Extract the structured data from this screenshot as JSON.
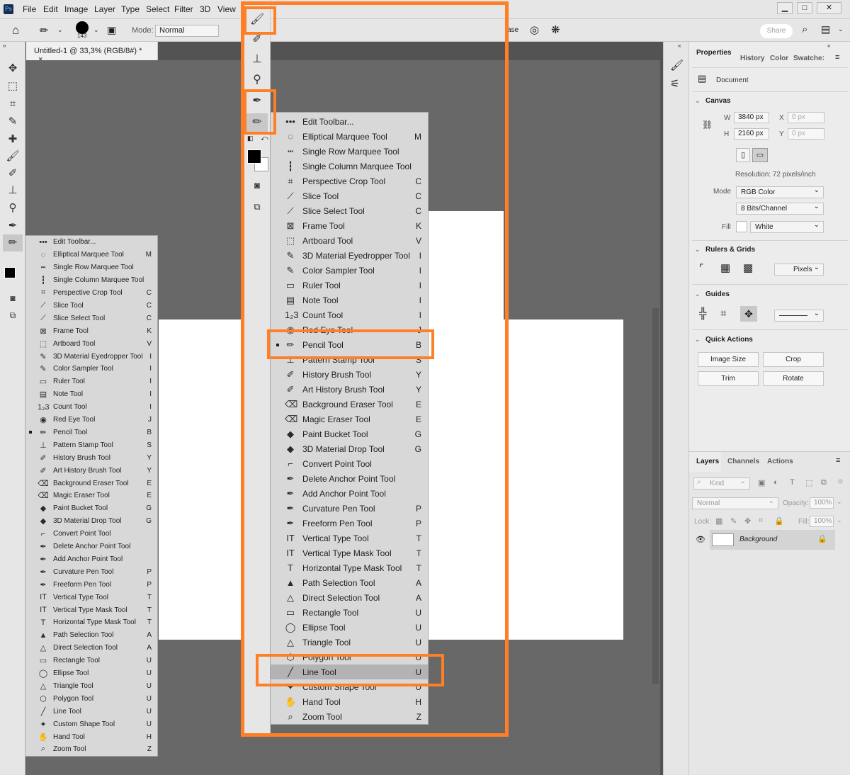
{
  "app": {
    "logo": "Ps"
  },
  "menu": [
    "File",
    "Edit",
    "Image",
    "Layer",
    "Type",
    "Select",
    "Filter",
    "3D",
    "View"
  ],
  "options": {
    "brush_size": "143",
    "mode_label": "Mode:",
    "mode_value": "Normal",
    "erase_fragment": "ase",
    "share": "Share"
  },
  "document_tab": {
    "title": "Untitled-1 @ 33,3% (RGB/8#) *",
    "close": "×"
  },
  "right_panel": {
    "tabs": [
      "Properties",
      "History",
      "Color",
      "Swatche:"
    ],
    "doc_label": "Document",
    "canvas": {
      "title": "Canvas",
      "w_label": "W",
      "w": "3840 px",
      "h_label": "H",
      "h": "2160 px",
      "x_label": "X",
      "x": "0 px",
      "y_label": "Y",
      "y": "0 px",
      "resolution": "Resolution: 72 pixels/inch",
      "mode_label": "Mode",
      "mode": "RGB Color",
      "bits": "8 Bits/Channel",
      "fill_label": "Fill",
      "fill": "White"
    },
    "rulers": {
      "title": "Rulers & Grids",
      "units": "Pixels"
    },
    "guides": {
      "title": "Guides"
    },
    "quick_actions": {
      "title": "Quick Actions",
      "buttons": [
        "Image Size",
        "Crop",
        "Trim",
        "Rotate"
      ]
    },
    "layers": {
      "tabs": [
        "Layers",
        "Channels",
        "Actions"
      ],
      "kind": "Kind",
      "blend": "Normal",
      "opacity_label": "Opacity:",
      "opacity": "100%",
      "lock_label": "Lock:",
      "fill_label": "Fill:",
      "fill": "100%",
      "layer_name": "Background"
    }
  },
  "flyout_left": {
    "items": [
      {
        "icon": "•••",
        "name": "Edit Toolbar...",
        "key": ""
      },
      {
        "icon": "◌",
        "name": "Elliptical Marquee Tool",
        "key": "M"
      },
      {
        "icon": "┅",
        "name": "Single Row Marquee Tool",
        "key": ""
      },
      {
        "icon": "┇",
        "name": "Single Column Marquee Tool",
        "key": ""
      },
      {
        "icon": "⌗",
        "name": "Perspective Crop Tool",
        "key": "C"
      },
      {
        "icon": "⟋",
        "name": "Slice Tool",
        "key": "C"
      },
      {
        "icon": "⟋",
        "name": "Slice Select Tool",
        "key": "C"
      },
      {
        "icon": "⊠",
        "name": "Frame Tool",
        "key": "K"
      },
      {
        "icon": "⬚",
        "name": "Artboard Tool",
        "key": "V"
      },
      {
        "icon": "✎",
        "name": "3D Material Eyedropper Tool",
        "key": "I"
      },
      {
        "icon": "✎",
        "name": "Color Sampler Tool",
        "key": "I"
      },
      {
        "icon": "▭",
        "name": "Ruler Tool",
        "key": "I"
      },
      {
        "icon": "▤",
        "name": "Note Tool",
        "key": "I"
      },
      {
        "icon": "1₂3",
        "name": "Count Tool",
        "key": "I"
      },
      {
        "icon": "◉",
        "name": "Red Eye Tool",
        "key": "J"
      },
      {
        "icon": "✏",
        "name": "Pencil Tool",
        "key": "B"
      },
      {
        "icon": "⊥",
        "name": "Pattern Stamp Tool",
        "key": "S"
      },
      {
        "icon": "✐",
        "name": "History Brush Tool",
        "key": "Y"
      },
      {
        "icon": "✐",
        "name": "Art History Brush Tool",
        "key": "Y"
      },
      {
        "icon": "⌫",
        "name": "Background Eraser Tool",
        "key": "E"
      },
      {
        "icon": "⌫",
        "name": "Magic Eraser Tool",
        "key": "E"
      },
      {
        "icon": "◆",
        "name": "Paint Bucket Tool",
        "key": "G"
      },
      {
        "icon": "◆",
        "name": "3D Material Drop Tool",
        "key": "G"
      },
      {
        "icon": "⌐",
        "name": "Convert Point Tool",
        "key": ""
      },
      {
        "icon": "✒",
        "name": "Delete Anchor Point Tool",
        "key": ""
      },
      {
        "icon": "✒",
        "name": "Add Anchor Point Tool",
        "key": ""
      },
      {
        "icon": "✒",
        "name": "Curvature Pen Tool",
        "key": "P"
      },
      {
        "icon": "✒",
        "name": "Freeform Pen Tool",
        "key": "P"
      },
      {
        "icon": "IT",
        "name": "Vertical Type Tool",
        "key": "T"
      },
      {
        "icon": "IT",
        "name": "Vertical Type Mask Tool",
        "key": "T"
      },
      {
        "icon": "T",
        "name": "Horizontal Type Mask Tool",
        "key": "T"
      },
      {
        "icon": "▲",
        "name": "Path Selection Tool",
        "key": "A"
      },
      {
        "icon": "△",
        "name": "Direct Selection Tool",
        "key": "A"
      },
      {
        "icon": "▭",
        "name": "Rectangle Tool",
        "key": "U"
      },
      {
        "icon": "◯",
        "name": "Ellipse Tool",
        "key": "U"
      },
      {
        "icon": "△",
        "name": "Triangle Tool",
        "key": "U"
      },
      {
        "icon": "⬡",
        "name": "Polygon Tool",
        "key": "U"
      },
      {
        "icon": "╱",
        "name": "Line Tool",
        "key": "U"
      },
      {
        "icon": "✦",
        "name": "Custom Shape Tool",
        "key": "U"
      },
      {
        "icon": "✋",
        "name": "Hand Tool",
        "key": "H"
      },
      {
        "icon": "⌕",
        "name": "Zoom Tool",
        "key": "Z"
      }
    ]
  },
  "flyout_main": {
    "items": [
      {
        "icon": "•••",
        "name": "Edit Toolbar...",
        "key": ""
      },
      {
        "icon": "◌",
        "name": "Elliptical Marquee Tool",
        "key": "M"
      },
      {
        "icon": "┅",
        "name": "Single Row Marquee Tool",
        "key": ""
      },
      {
        "icon": "┇",
        "name": "Single Column Marquee Tool",
        "key": ""
      },
      {
        "icon": "⌗",
        "name": "Perspective Crop Tool",
        "key": "C"
      },
      {
        "icon": "⟋",
        "name": "Slice Tool",
        "key": "C"
      },
      {
        "icon": "⟋",
        "name": "Slice Select Tool",
        "key": "C"
      },
      {
        "icon": "⊠",
        "name": "Frame Tool",
        "key": "K"
      },
      {
        "icon": "⬚",
        "name": "Artboard Tool",
        "key": "V"
      },
      {
        "icon": "✎",
        "name": "3D Material Eyedropper Tool",
        "key": "I"
      },
      {
        "icon": "✎",
        "name": "Color Sampler Tool",
        "key": "I"
      },
      {
        "icon": "▭",
        "name": "Ruler Tool",
        "key": "I"
      },
      {
        "icon": "▤",
        "name": "Note Tool",
        "key": "I"
      },
      {
        "icon": "1₂3",
        "name": "Count Tool",
        "key": "I"
      },
      {
        "icon": "◉",
        "name": "Red Eye Tool",
        "key": "J"
      },
      {
        "icon": "✏",
        "name": "Pencil Tool",
        "key": "B"
      },
      {
        "icon": "⊥",
        "name": "Pattern Stamp Tool",
        "key": "S"
      },
      {
        "icon": "✐",
        "name": "History Brush Tool",
        "key": "Y"
      },
      {
        "icon": "✐",
        "name": "Art History Brush Tool",
        "key": "Y"
      },
      {
        "icon": "⌫",
        "name": "Background Eraser Tool",
        "key": "E"
      },
      {
        "icon": "⌫",
        "name": "Magic Eraser Tool",
        "key": "E"
      },
      {
        "icon": "◆",
        "name": "Paint Bucket Tool",
        "key": "G"
      },
      {
        "icon": "◆",
        "name": "3D Material Drop Tool",
        "key": "G"
      },
      {
        "icon": "⌐",
        "name": "Convert Point Tool",
        "key": ""
      },
      {
        "icon": "✒",
        "name": "Delete Anchor Point Tool",
        "key": ""
      },
      {
        "icon": "✒",
        "name": "Add Anchor Point Tool",
        "key": ""
      },
      {
        "icon": "✒",
        "name": "Curvature Pen Tool",
        "key": "P"
      },
      {
        "icon": "✒",
        "name": "Freeform Pen Tool",
        "key": "P"
      },
      {
        "icon": "IT",
        "name": "Vertical Type Tool",
        "key": "T"
      },
      {
        "icon": "IT",
        "name": "Vertical Type Mask Tool",
        "key": "T"
      },
      {
        "icon": "T",
        "name": "Horizontal Type Mask Tool",
        "key": "T"
      },
      {
        "icon": "▲",
        "name": "Path Selection Tool",
        "key": "A"
      },
      {
        "icon": "△",
        "name": "Direct Selection Tool",
        "key": "A"
      },
      {
        "icon": "▭",
        "name": "Rectangle Tool",
        "key": "U"
      },
      {
        "icon": "◯",
        "name": "Ellipse Tool",
        "key": "U"
      },
      {
        "icon": "△",
        "name": "Triangle Tool",
        "key": "U"
      },
      {
        "icon": "⬡",
        "name": "Polygon Tool",
        "key": "U"
      },
      {
        "icon": "╱",
        "name": "Line Tool",
        "key": "U"
      },
      {
        "icon": "✦",
        "name": "Custom Shape Tool",
        "key": "U"
      },
      {
        "icon": "✋",
        "name": "Hand Tool",
        "key": "H"
      },
      {
        "icon": "⌕",
        "name": "Zoom Tool",
        "key": "Z"
      }
    ]
  },
  "colors": {
    "highlight": "#ff7f27",
    "canvas": "#686868",
    "panel": "#e6e6e6"
  }
}
